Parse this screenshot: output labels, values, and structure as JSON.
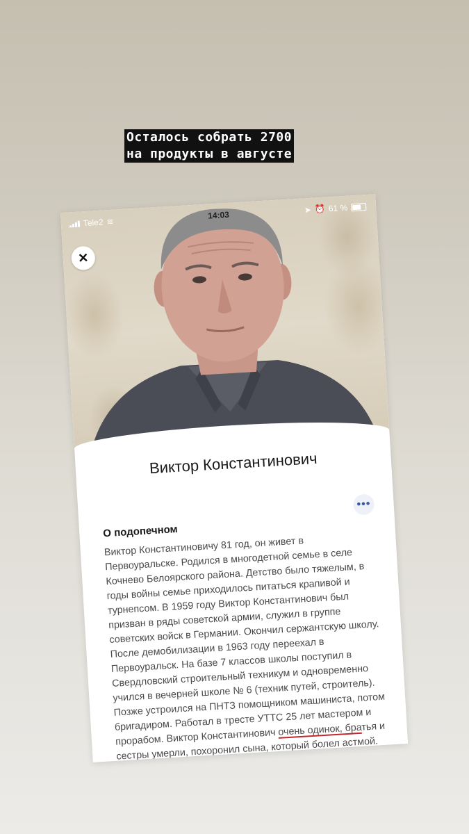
{
  "story": {
    "caption_line1": "Осталось собрать 2700",
    "caption_line2": "на продукты в августе"
  },
  "status_bar": {
    "carrier": "Tele2",
    "time": "14:03",
    "battery": "61 %"
  },
  "profile": {
    "name": "Виктор Константинович",
    "section_title": "О подопечном",
    "bio_part1": "Виктор Константиновичу 81 год, он живет в Первоуральске. Родился в многодетной семье в селе Кочнево Белоярского района. Детство было тяжелым, в годы войны семье приходилось питаться крапивой и турнепсом. В 1959 году Виктор Константинович был призван в ряды советской армии, служил в группе советских войск в Германии. Окончил сержантскую школу. После демобилизации в 1963 году переехал в Первоуральск. На базе 7 классов школы поступил в Свердловский строительный техникум и одновременно учился в вечерней школе № 6 (техник путей, строитель). Позже устроился на ПНТЗ помощником машиниста, потом бригадиром. Работал в тресте УТТС 25 лет мастером и прорабом. Виктор Константинович ",
    "bio_highlight": "очень одинок, бра",
    "bio_part2": "тья и сестры умерли, похоронил сына, который болел астмой. Перенес две операции на оба глаза и операцию по шунтированию сердца, есть катаракта, имеются проблемы со слухом, страдает от язвы желудка."
  },
  "colors": {
    "highlight_underline": "#c3272b",
    "more_button_dots": "#3b5ba9"
  }
}
